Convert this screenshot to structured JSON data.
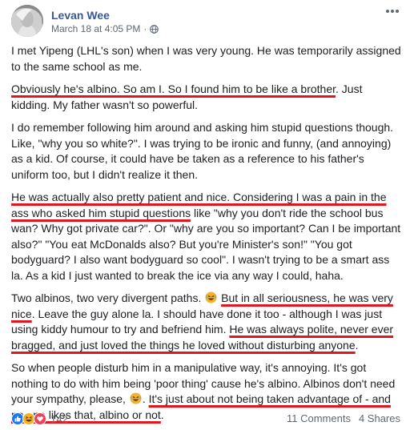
{
  "post": {
    "author": "Levan Wee",
    "timestamp": "March 18 at 4:05 PM",
    "separator": "·",
    "privacy_icon": "globe-icon",
    "paragraphs": {
      "p1": "I met Yipeng (LHL's son) when I was very young. He was temporarily assigned to the same school as me.",
      "p2_hl": "Obviously he's albino. So am I. So I found him to be like a brother",
      "p2_rest": ". Just kidding. My father wasn't so powerful.",
      "p3": "I do remember following him around and asking him stupid questions though. Like, \"why you so white?\". I was trying to be ironic and funny, (and annoying) as a kid. Of course, it could have be taken as a reference to his father's uniform too, but I didn't realize it then.",
      "p4_hl": "He was actually also pretty patient and nice. Considering I was a pain in the ass who asked him stupid questions",
      "p4_rest": " like \"why you don't ride the school bus wan? Why got private car?\". Or \"why are you so important? Can I be important also?\" \"You eat McDonalds also? But you're Minister's son!\" \"You got bodyguard? I also want bodyguard so cool\". I wasn't trying to be a smart ass la. As a kid I just wanted to break the ice via any way I could, haha.",
      "p5_a": "Two albinos, two very divergent paths. ",
      "p5_hl1": "But in all seriousness, he was very nice",
      "p5_b": ". Leave the guy alone la. I should have done it too - although I was just using kiddy humour to try and befriend him. ",
      "p5_hl2": "He was always polite, never ever bragged, and just loved the things he loved without disturbing anyone",
      "p5_c": ".",
      "p6_a": "So when people disturb him in a manipulative way, it's annoying. It's got nothing to do with him being 'poor thing' cause he's albino. Albinos don't need your sympathy, please, ",
      "p6_b": ". ",
      "p6_hl": "It's just about not being taken advantage of - and no one likes that, albino or not",
      "p6_c": "."
    },
    "emoji_name": "rolling-on-floor-laughing"
  },
  "footer": {
    "reaction_count": "142",
    "reactions": [
      "like-icon",
      "haha-icon",
      "love-icon"
    ],
    "comments": "11 Comments",
    "shares": "4 Shares"
  },
  "colors": {
    "author": "#385898",
    "highlight_underline": "#e0171e",
    "meta": "#606770",
    "like": "#1877f2",
    "love": "#f33e58",
    "haha": "#f7b125"
  }
}
